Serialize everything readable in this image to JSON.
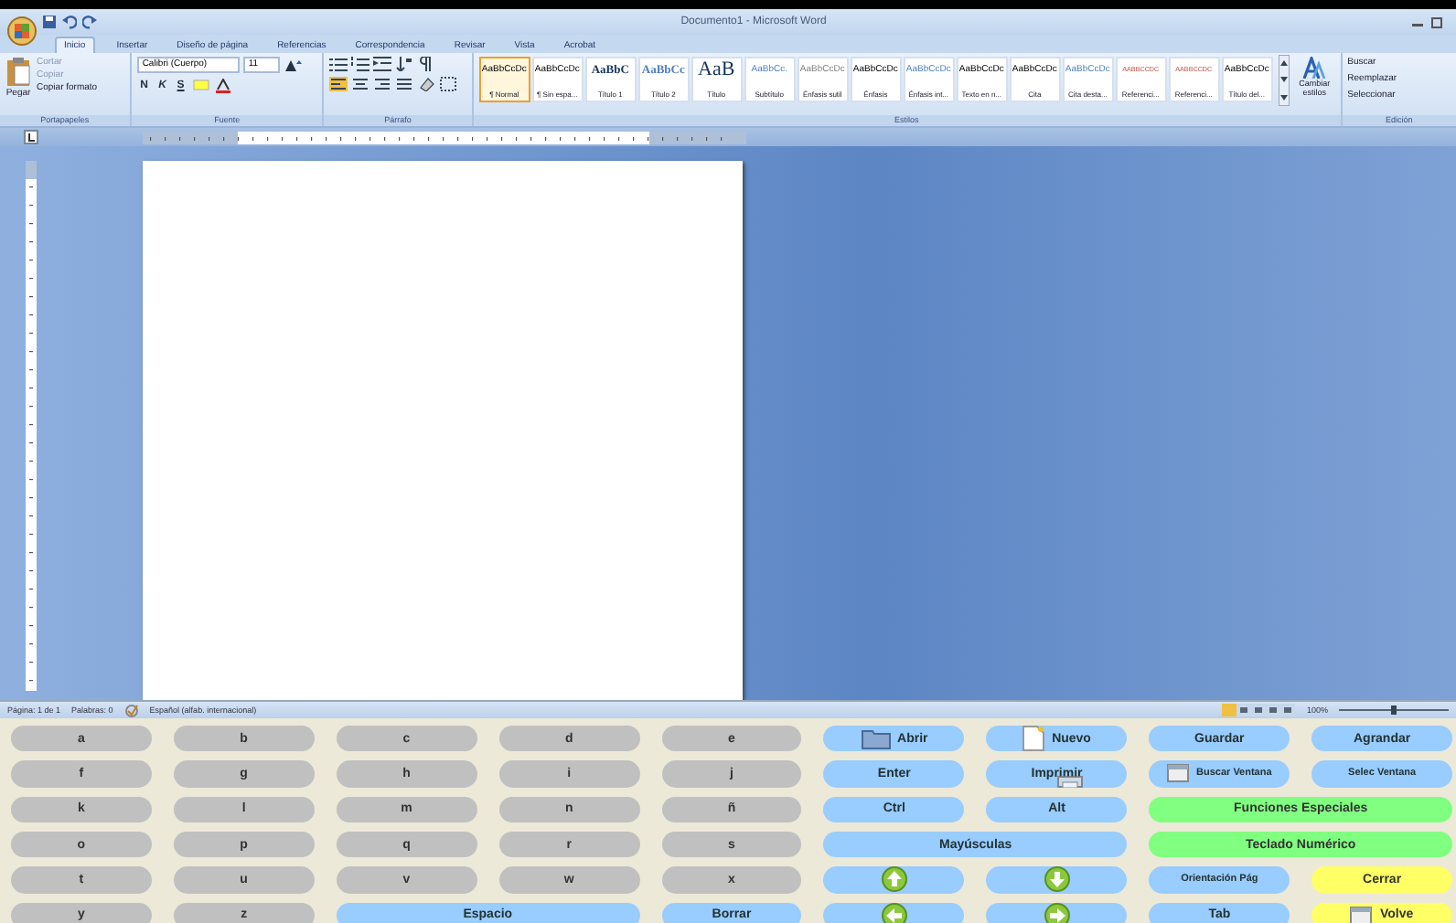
{
  "window": {
    "title": "Documento1 - Microsoft Word"
  },
  "ribbon_tabs": [
    {
      "label": "Inicio",
      "selected": true
    },
    {
      "label": "Insertar",
      "selected": false
    },
    {
      "label": "Diseño de página",
      "selected": false
    },
    {
      "label": "Referencias",
      "selected": false
    },
    {
      "label": "Correspondencia",
      "selected": false
    },
    {
      "label": "Revisar",
      "selected": false
    },
    {
      "label": "Vista",
      "selected": false
    },
    {
      "label": "Acrobat",
      "selected": false
    }
  ],
  "clipboard": {
    "paste": "Pegar",
    "items": [
      "Cortar",
      "Copiar",
      "Copiar formato"
    ],
    "label": "Portapapeles"
  },
  "font": {
    "family": "Calibri (Cuerpo)",
    "size": "11",
    "format_buttons": [
      "N",
      "K",
      "S"
    ],
    "label": "Fuente"
  },
  "paragraph": {
    "label": "Párrafo"
  },
  "styles": {
    "label": "Estilos",
    "change": "Cambiar estilos",
    "items": [
      {
        "preview": "AaBbCcDc",
        "name": "¶ Normal",
        "selected": true
      },
      {
        "preview": "AaBbCcDc",
        "name": "¶ Sin espa...",
        "selected": false
      },
      {
        "preview": "AaBbC",
        "name": "Título 1",
        "selected": false
      },
      {
        "preview": "AaBbCc",
        "name": "Título 2",
        "selected": false
      },
      {
        "preview": "AaB",
        "name": "Título",
        "selected": false
      },
      {
        "preview": "AaBbCc.",
        "name": "Subtítulo",
        "selected": false
      },
      {
        "preview": "AaBbCcDc",
        "name": "Énfasis sutil",
        "selected": false
      },
      {
        "preview": "AaBbCcDc",
        "name": "Énfasis",
        "selected": false
      },
      {
        "preview": "AaBbCcDc",
        "name": "Énfasis int...",
        "selected": false
      },
      {
        "preview": "AaBbCcDc",
        "name": "Texto en n...",
        "selected": false
      },
      {
        "preview": "AaBbCcDc",
        "name": "Cita",
        "selected": false
      },
      {
        "preview": "AaBbCcDc",
        "name": "Cita desta...",
        "selected": false
      },
      {
        "preview": "AABBCCDC",
        "name": "Referenci...",
        "selected": false
      },
      {
        "preview": "AABBCCDC",
        "name": "Referenci...",
        "selected": false
      },
      {
        "preview": "AaBbCcDc",
        "name": "Título del...",
        "selected": false
      }
    ]
  },
  "editing": {
    "label": "Edición",
    "items": [
      "Buscar",
      "Reemplazar",
      "Seleccionar"
    ]
  },
  "status_bar": {
    "page": "Página: 1 de 1",
    "words": "Palabras: 0",
    "language": "Español (alfab. internacional)",
    "zoom": "100%",
    "zoom_slider": {
      "level": 0.5
    }
  },
  "keyboard": {
    "keys": [
      {
        "label": "a",
        "kind": "letter"
      },
      {
        "label": "b",
        "kind": "letter"
      },
      {
        "label": "c",
        "kind": "letter"
      },
      {
        "label": "d",
        "kind": "letter"
      },
      {
        "label": "e",
        "kind": "letter"
      },
      {
        "label": "Abrir",
        "kind": "open"
      },
      {
        "label": "Nuevo",
        "kind": "new"
      },
      {
        "label": "Guardar",
        "kind": "action"
      },
      {
        "label": "Agrandar",
        "kind": "action"
      },
      {
        "label": "f",
        "kind": "letter"
      },
      {
        "label": "g",
        "kind": "letter"
      },
      {
        "label": "h",
        "kind": "letter"
      },
      {
        "label": "i",
        "kind": "letter"
      },
      {
        "label": "j",
        "kind": "letter"
      },
      {
        "label": "Enter",
        "kind": "action"
      },
      {
        "label": "Imprimir",
        "kind": "print"
      },
      {
        "label": "Buscar Ventana",
        "kind": "find_window"
      },
      {
        "label": "Selec Ventana",
        "kind": "small_action"
      },
      {
        "label": "k",
        "kind": "letter"
      },
      {
        "label": "l",
        "kind": "letter"
      },
      {
        "label": "m",
        "kind": "letter"
      },
      {
        "label": "n",
        "kind": "letter"
      },
      {
        "label": "ñ",
        "kind": "letter"
      },
      {
        "label": "Ctrl",
        "kind": "action"
      },
      {
        "label": "Alt",
        "kind": "action"
      },
      {
        "label": "Funciones Especiales",
        "kind": "special"
      },
      {
        "label": "o",
        "kind": "letter"
      },
      {
        "label": "p",
        "kind": "letter"
      },
      {
        "label": "q",
        "kind": "letter"
      },
      {
        "label": "r",
        "kind": "letter"
      },
      {
        "label": "s",
        "kind": "letter"
      },
      {
        "label": "Mayúsculas",
        "kind": "wide"
      },
      {
        "label": "Teclado Numérico",
        "kind": "special"
      },
      {
        "label": "t",
        "kind": "letter"
      },
      {
        "label": "u",
        "kind": "letter"
      },
      {
        "label": "v",
        "kind": "letter"
      },
      {
        "label": "w",
        "kind": "letter"
      },
      {
        "label": "x",
        "kind": "letter"
      },
      {
        "kind": "up"
      },
      {
        "kind": "down"
      },
      {
        "label": "Orientación Pág",
        "kind": "small_action"
      },
      {
        "label": "Cerrar",
        "kind": "exit"
      },
      {
        "label": "y",
        "kind": "letter"
      },
      {
        "label": "z",
        "kind": "letter"
      },
      {
        "label": "Espacio",
        "kind": "wide"
      },
      {
        "label": "Borrar",
        "kind": "action"
      },
      {
        "kind": "left"
      },
      {
        "kind": "right"
      },
      {
        "label": "Tab",
        "kind": "action"
      },
      {
        "label": "Volve",
        "kind": "back"
      }
    ]
  }
}
